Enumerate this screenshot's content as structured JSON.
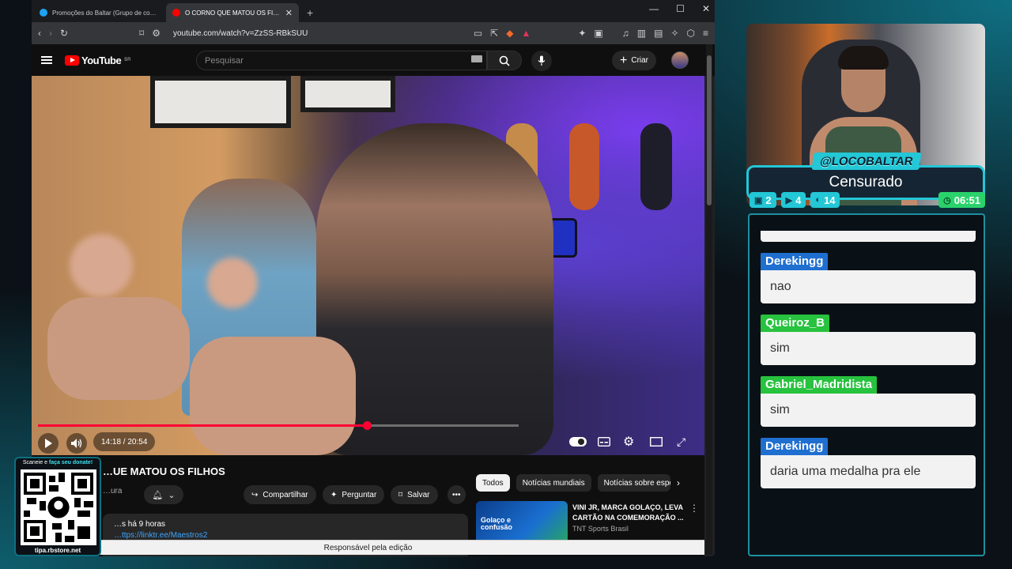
{
  "browser": {
    "tabs": [
      {
        "title": "Promoções do Baltar (Grupo de comentários)",
        "favicon_color": "#1da1f2",
        "active": false
      },
      {
        "title": "O CORNO QUE MATOU OS FILHOS - YouTube",
        "favicon_color": "#ff0000",
        "active": true
      }
    ],
    "new_tab": "+",
    "url": "youtube.com/watch?v=ZzSS-RBkSUU"
  },
  "youtube": {
    "logo_text": "YouTube",
    "region": "BR",
    "search_placeholder": "Pesquisar",
    "create_label": "Criar",
    "player": {
      "time": "14:18 / 20:54",
      "progress_fraction": 0.684
    },
    "video_title": "…UE MATOU OS FILHOS",
    "channel_name": "…ura",
    "actions": {
      "share": "Compartilhar",
      "ask": "Perguntar",
      "save": "Salvar"
    },
    "description": {
      "date": "…s  há 9 horas",
      "link": "…ttps://linktr.ee/Maestros2"
    },
    "chips": [
      "Todos",
      "Notícias mundiais",
      "Notícias sobre espo"
    ],
    "recommended": {
      "title": "VINI JR, MARCA GOLAÇO, LEVA CARTÃO NA COMEMORAÇÃO ...",
      "channel": "TNT Sports Brasil",
      "thumb_text": "Golaço e confusão"
    },
    "status_bar": "Responsável pela edição"
  },
  "overlay": {
    "qr_top_a": "Scaneie e ",
    "qr_top_b": "faça seu donate!",
    "qr_bottom": "tipa.rbstore.net",
    "streamer_handle": "@LOCOBALTAR",
    "streamer_status": "Censurado",
    "stats": {
      "twitch": "2",
      "youtube": "4",
      "kick": "14",
      "uptime": "06:51"
    }
  },
  "chat": {
    "messages": [
      {
        "user": "Derekingg",
        "text": "nao",
        "color": "#1f6fd0"
      },
      {
        "user": "Queiroz_B",
        "text": "sim",
        "color": "#27c23e"
      },
      {
        "user": "Gabriel_Madridista",
        "text": "sim",
        "color": "#27c23e"
      },
      {
        "user": "Derekingg",
        "text": "daria uma medalha pra ele",
        "color": "#1f6fd0"
      }
    ]
  },
  "colors": {
    "accent_cyan": "#23c7d6",
    "youtube_red": "#ff0000",
    "uptime_green": "#2bd26b"
  }
}
